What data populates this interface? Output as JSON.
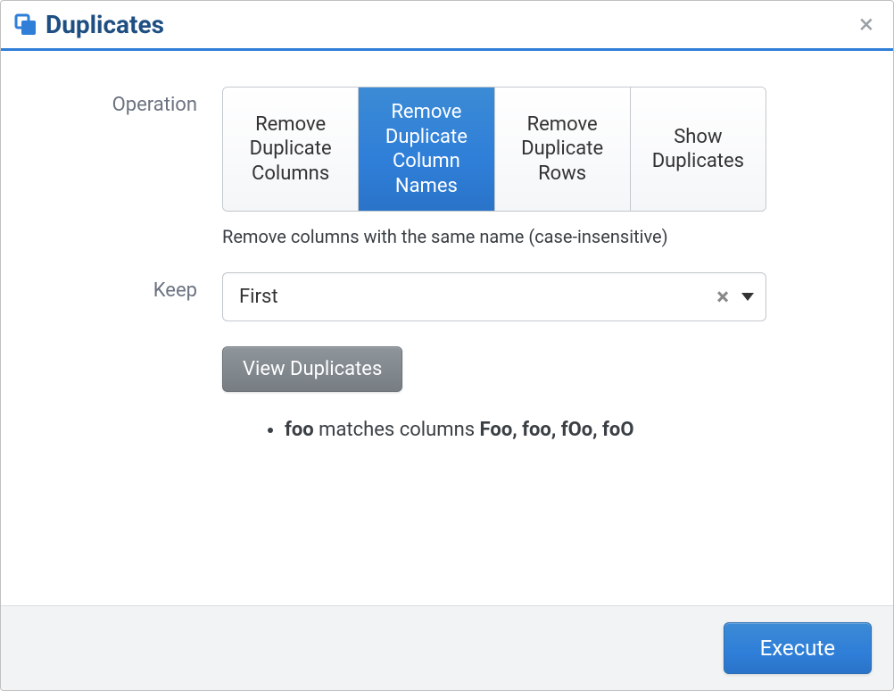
{
  "header": {
    "title": "Duplicates",
    "icon_name": "duplicates-icon"
  },
  "form": {
    "operation": {
      "label": "Operation",
      "options": [
        {
          "label": "Remove Duplicate Columns",
          "selected": false
        },
        {
          "label": "Remove Duplicate Column Names",
          "selected": true
        },
        {
          "label": "Remove Duplicate Rows",
          "selected": false
        },
        {
          "label": "Show Duplicates",
          "selected": false
        }
      ],
      "description": "Remove columns with the same name (case-insensitive)"
    },
    "keep": {
      "label": "Keep",
      "value": "First"
    },
    "view_button": "View Duplicates",
    "matches": [
      {
        "key": "foo",
        "mid_text": " matches columns ",
        "columns": "Foo, foo, fOo, foO"
      }
    ]
  },
  "footer": {
    "execute": "Execute"
  }
}
